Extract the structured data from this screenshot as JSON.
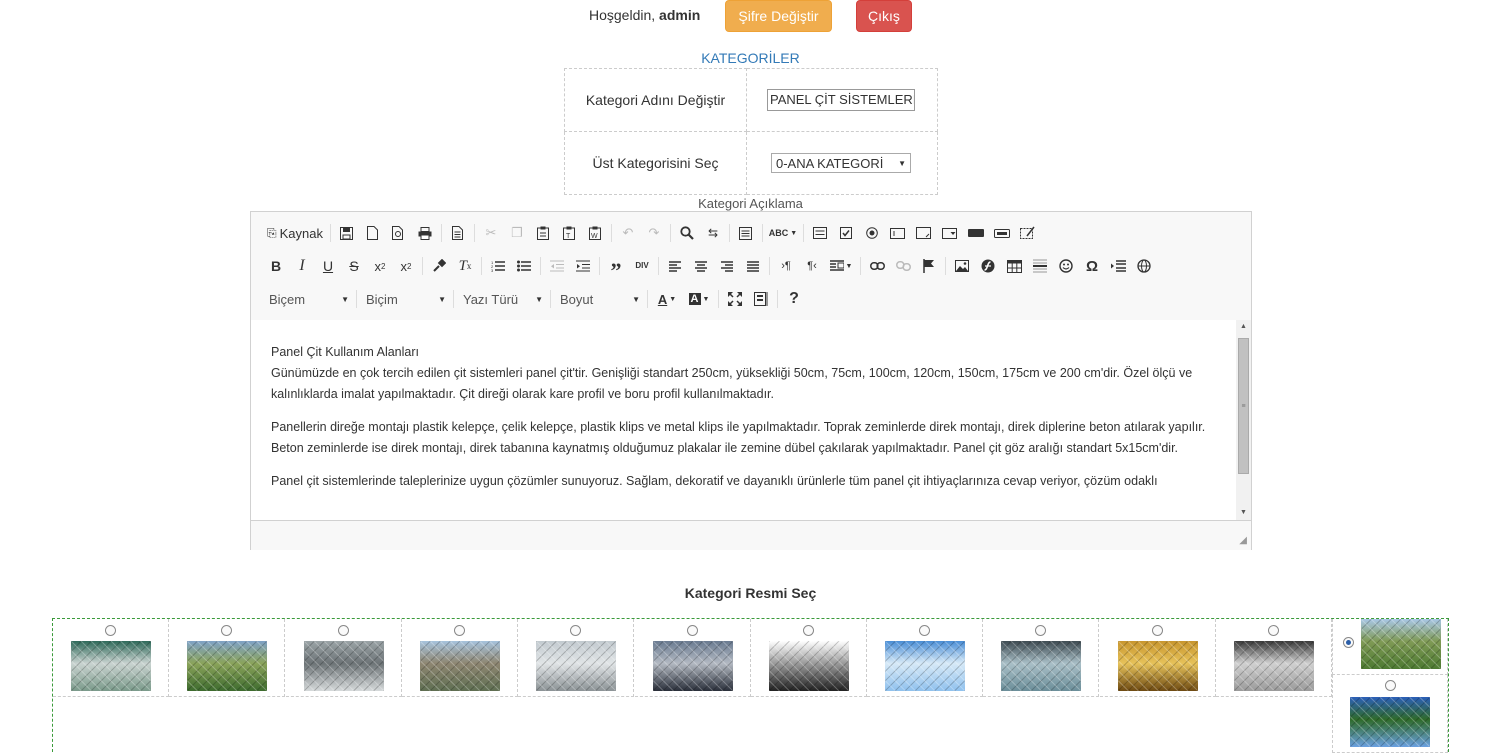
{
  "header": {
    "welcome_prefix": "Hoşgeldin,",
    "username": "admin",
    "change_password_label": "Şifre Değiştir",
    "logout_label": "Çıkış"
  },
  "categories": {
    "title": "KATEGORİLER",
    "rename_label": "Kategori Adını Değiştir",
    "rename_value": "PANEL ÇİT SİSTEMLERİ",
    "parent_label": "Üst Kategorisini Seç",
    "parent_selected": "0-ANA KATEGORİ"
  },
  "editor": {
    "description_label": "Kategori Açıklama",
    "source_label": "Kaynak",
    "combo_format": "Biçem",
    "combo_style": "Biçim",
    "combo_font": "Yazı Türü",
    "combo_size": "Boyut",
    "paragraphs": [
      "Panel Çit Kullanım Alanları",
      "Günümüzde en çok tercih edilen çit sistemleri panel çit'tir. Genişliği standart 250cm, yüksekliği 50cm, 75cm, 100cm, 120cm, 150cm, 175cm ve 200 cm'dir. Özel ölçü ve kalınlıklarda imalat yapılmaktadır. Çit direği olarak kare profil ve boru profil kullanılmaktadır.",
      "Panellerin direğe montajı plastik kelepçe, çelik kelepçe, plastik klips ve metal klips ile yapılmaktadır. Toprak zeminlerde direk montajı, direk diplerine beton atılarak yapılır. Beton zeminlerde ise direk montajı, direk tabanına kaynatmış olduğumuz plakalar ile zemine dübel çakılarak yapılmaktadır. Panel çit göz aralığı standart 5x15cm'dir.",
      "Panel çit sistemlerinde taleplerinize uygun çözümler sunuyoruz. Sağlam, dekoratif ve dayanıklı ürünlerle tüm panel çit ihtiyaçlarınıza cevap veriyor, çözüm odaklı"
    ]
  },
  "image_select": {
    "title": "Kategori Resmi Seç",
    "selected_index": 11,
    "images": [
      {
        "icon": "green-panel-fence-photo"
      },
      {
        "icon": "panel-fence-field-photo"
      },
      {
        "icon": "wire-mesh-rolls-photo"
      },
      {
        "icon": "fence-post-field-photo"
      },
      {
        "icon": "chain-link-fence-photo"
      },
      {
        "icon": "dark-chain-link-photo"
      },
      {
        "icon": "barbed-wire-photo"
      },
      {
        "icon": "chain-link-blue-sky-photo"
      },
      {
        "icon": "chain-link-closeup-photo"
      },
      {
        "icon": "chain-link-sunset-photo"
      },
      {
        "icon": "fence-bw-photo"
      },
      {
        "icon": "fence-field-selected-photo"
      },
      {
        "icon": "sports-field-photo"
      }
    ]
  }
}
